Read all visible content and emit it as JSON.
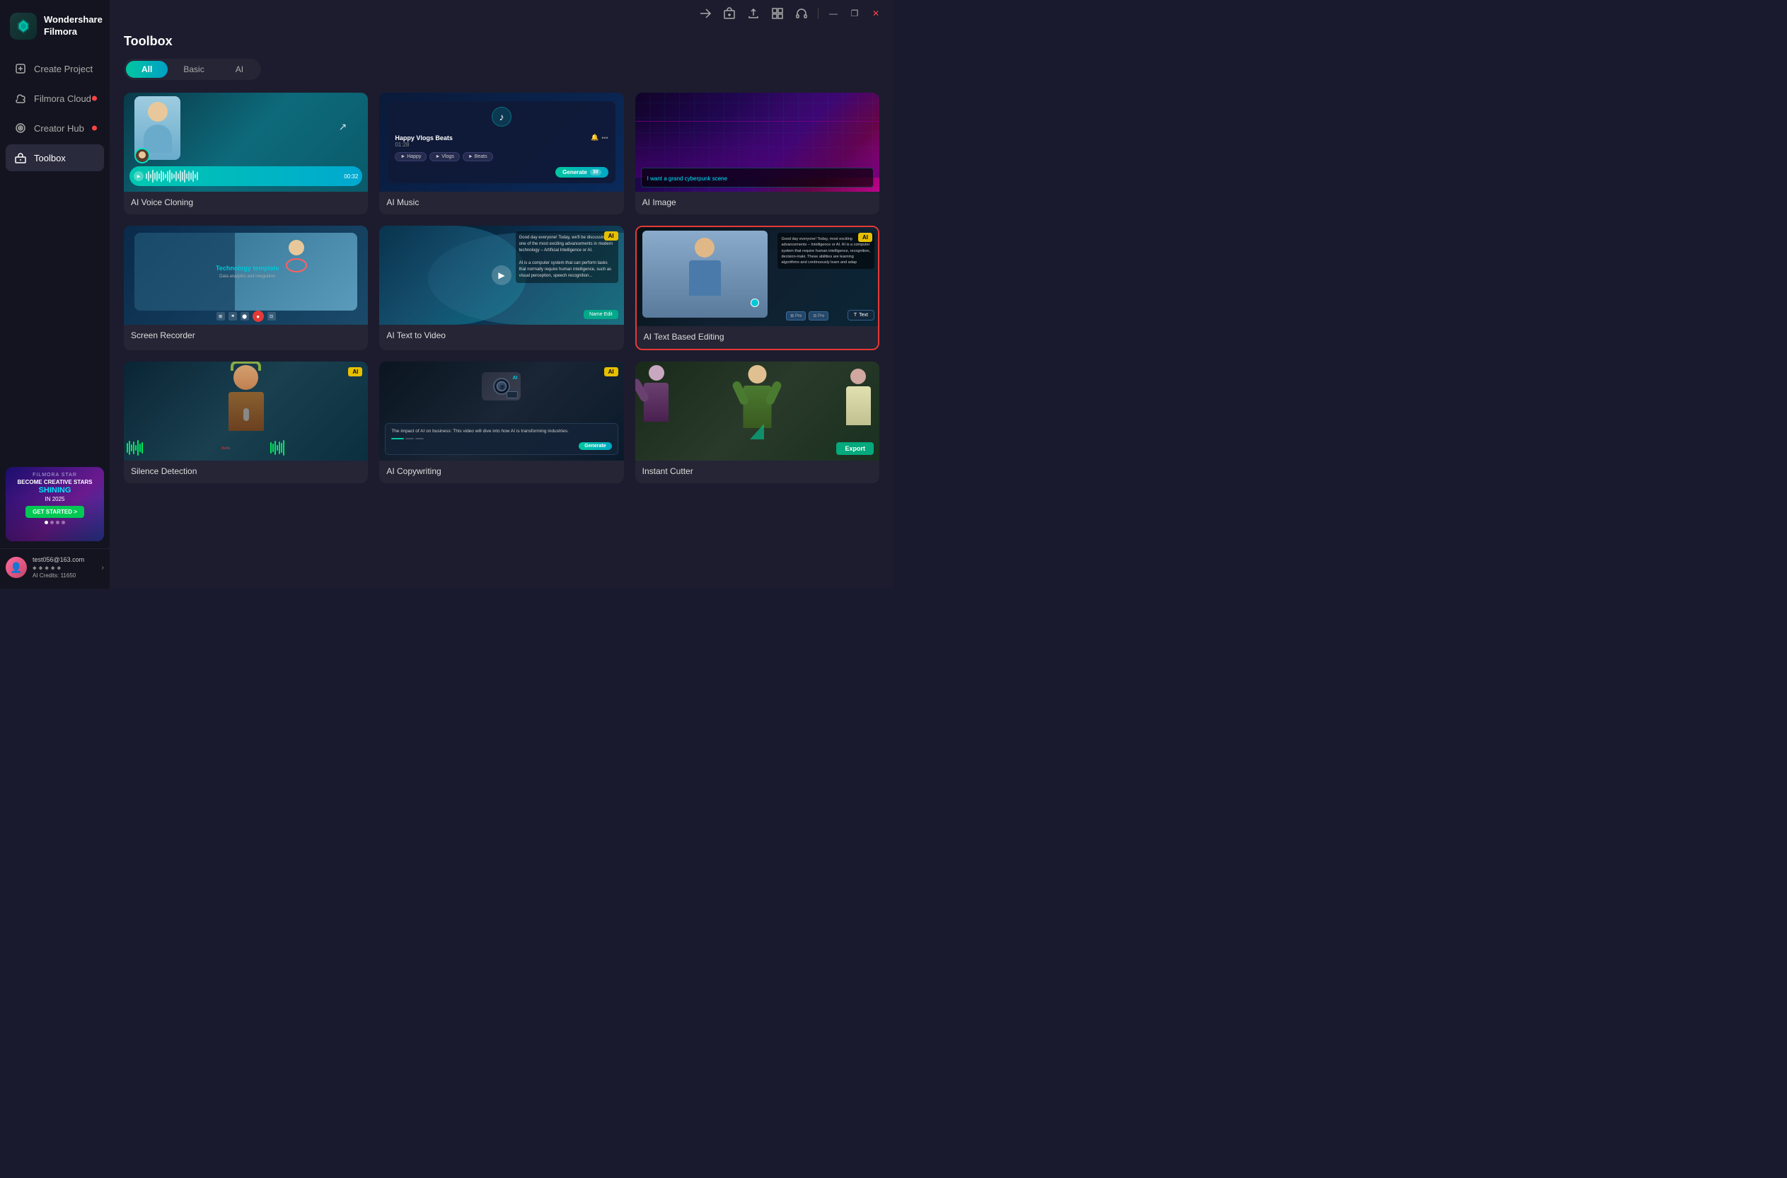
{
  "app": {
    "name": "Wondershare",
    "name2": "Filmora",
    "window_controls": {
      "minimize": "—",
      "maximize": "❐",
      "close": "✕"
    }
  },
  "sidebar": {
    "nav_items": [
      {
        "id": "create-project",
        "label": "Create Project",
        "icon": "plus-square",
        "dot": false,
        "active": false
      },
      {
        "id": "filmora-cloud",
        "label": "Filmora Cloud",
        "icon": "cloud",
        "dot": true,
        "active": false
      },
      {
        "id": "creator-hub",
        "label": "Creator Hub",
        "icon": "target",
        "dot": true,
        "active": false
      },
      {
        "id": "toolbox",
        "label": "Toolbox",
        "icon": "toolbox",
        "dot": false,
        "active": true
      }
    ],
    "banner": {
      "star_text": "FILMORA STAR",
      "become": "BECOME CREATIVE STARS",
      "shining": "SHINING",
      "year": "IN 2025",
      "cta": "GET STARTED >"
    },
    "user": {
      "email": "test056@163.com",
      "credits_label": "AI Credits: 11650",
      "avatar_emoji": "👤"
    }
  },
  "main": {
    "page_title": "Toolbox",
    "filter_tabs": [
      "All",
      "Basic",
      "AI"
    ],
    "active_filter": "All",
    "tools": [
      {
        "id": "ai-voice-cloning",
        "label": "AI Voice Cloning",
        "has_ai_badge": false,
        "selected": false,
        "thumb_type": "voice"
      },
      {
        "id": "ai-music",
        "label": "AI Music",
        "has_ai_badge": false,
        "selected": false,
        "thumb_type": "music",
        "music_title": "Happy Vlogs Beats",
        "music_time": "01:28",
        "music_tags": [
          "Happy",
          "Vlogs",
          "Beats"
        ],
        "music_generate": "Generate",
        "music_count": "30"
      },
      {
        "id": "ai-image",
        "label": "AI Image",
        "has_ai_badge": false,
        "selected": false,
        "thumb_type": "image",
        "prompt": "I want a grand cyberpunk scene"
      },
      {
        "id": "screen-recorder",
        "label": "Screen Recorder",
        "has_ai_badge": false,
        "selected": false,
        "thumb_type": "recorder",
        "template_title": "Technology template",
        "template_sub": "Data analytics and integration"
      },
      {
        "id": "ai-text-to-video",
        "label": "AI Text to Video",
        "has_ai_badge": true,
        "selected": false,
        "thumb_type": "text-video",
        "desc": "Good day everyone! Today, we'll be discussing one of the most exciting advancements in modern technology – Artificial Intelligence or AI. AI is a computer system that can perform tasks that normally require human intelligence..."
      },
      {
        "id": "ai-text-based-editing",
        "label": "AI Text Based Editing",
        "has_ai_badge": true,
        "selected": true,
        "thumb_type": "text-edit",
        "desc": "Good day everyone! Today, most exciting advancements – Intelligence or AI. AI is a computer system that require human intelligence, recognition, decision-maki. These abilities are lem learning algorithms and d continuously learn and adap"
      },
      {
        "id": "silence-detection",
        "label": "Silence Detection",
        "has_ai_badge": true,
        "selected": false,
        "thumb_type": "silence"
      },
      {
        "id": "ai-copywriting",
        "label": "AI Copywriting",
        "has_ai_badge": true,
        "selected": false,
        "thumb_type": "copywriting",
        "copy_text": "The impact of AI on business: This video will dive into how AI is transforming industries."
      },
      {
        "id": "instant-cutter",
        "label": "Instant Cutter",
        "has_ai_badge": false,
        "selected": false,
        "thumb_type": "cutter",
        "export_label": "Export"
      }
    ]
  },
  "topbar": {
    "icons": [
      "send",
      "present",
      "upload",
      "grid",
      "headphones"
    ]
  }
}
